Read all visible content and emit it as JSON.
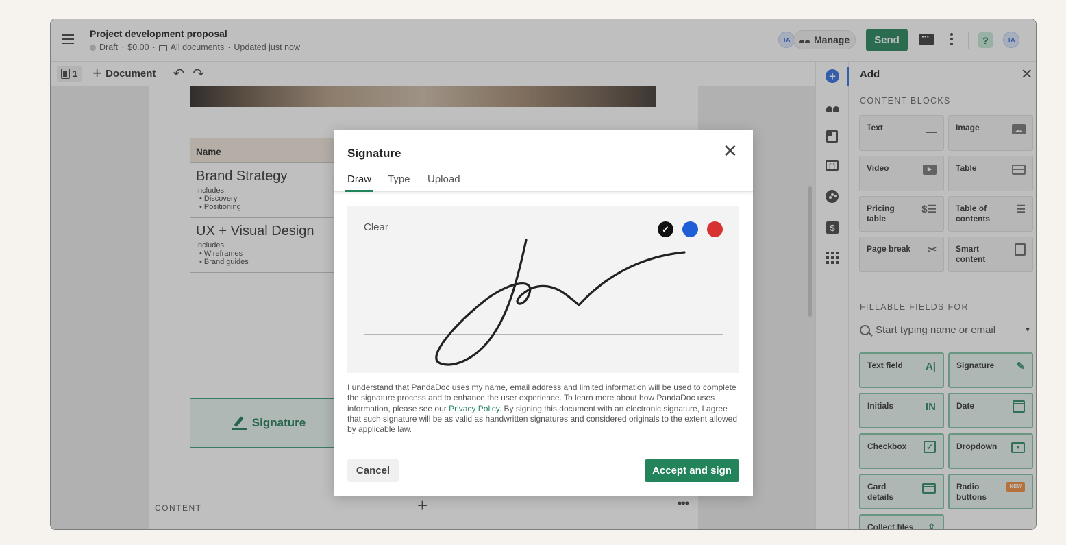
{
  "header": {
    "title": "Project development proposal",
    "status": "Draft",
    "amount": "$0.00",
    "folder": "All documents",
    "updated": "Updated just now",
    "avatar_initials": "TA",
    "manage_label": "Manage",
    "send_label": "Send",
    "help_label": "?",
    "avatar2_initials": "TA"
  },
  "toolbar": {
    "pages_count": "1",
    "add_document_label": "Document"
  },
  "document": {
    "table_header": "Name",
    "rows": [
      {
        "title": "Brand Strategy",
        "includes": "Includes:",
        "items": [
          "• Discovery",
          "• Positioning"
        ]
      },
      {
        "title": "UX + Visual Design",
        "includes": "Includes:",
        "items": [
          "• Wireframes",
          "• Brand guides"
        ]
      }
    ],
    "signature_field_label": "Signature",
    "content_label": "CONTENT",
    "content_add": "+",
    "content_more": "•••"
  },
  "panel": {
    "title": "Add",
    "content_blocks_label": "CONTENT BLOCKS",
    "content_blocks": [
      {
        "label": "Text",
        "icon": "text-icon"
      },
      {
        "label": "Image",
        "icon": "image-icon"
      },
      {
        "label": "Video",
        "icon": "video-icon"
      },
      {
        "label": "Table",
        "icon": "table-icon"
      },
      {
        "label": "Pricing table",
        "icon": "pricing-icon",
        "glyph": "$☰"
      },
      {
        "label": "Table of contents",
        "icon": "toc-icon",
        "glyph": "☰"
      },
      {
        "label": "Page break",
        "icon": "scissors-icon",
        "glyph": "✂"
      },
      {
        "label": "Smart content",
        "icon": "smart-content-icon"
      }
    ],
    "fillable_label": "FILLABLE FIELDS FOR",
    "recipient_placeholder": "Start typing name or email",
    "fields": [
      {
        "label": "Text field",
        "icon": "text-field-icon",
        "glyph": "A|"
      },
      {
        "label": "Signature",
        "icon": "signature-icon",
        "glyph": "✎"
      },
      {
        "label": "Initials",
        "icon": "initials-icon",
        "glyph": "IN"
      },
      {
        "label": "Date",
        "icon": "calendar-icon"
      },
      {
        "label": "Checkbox",
        "icon": "checkbox-icon",
        "glyph": "✓"
      },
      {
        "label": "Dropdown",
        "icon": "dropdown-icon",
        "glyph": "▼"
      },
      {
        "label": "Card details",
        "icon": "card-icon"
      },
      {
        "label": "Radio buttons",
        "icon": "new-badge",
        "badge": "NEW"
      },
      {
        "label": "Collect files",
        "icon": "upload-icon",
        "glyph": "⇪"
      }
    ]
  },
  "modal": {
    "title": "Signature",
    "tabs": [
      "Draw",
      "Type",
      "Upload"
    ],
    "active_tab": "Draw",
    "clear_label": "Clear",
    "colors": [
      "#111111",
      "#1e5fd6",
      "#d63232"
    ],
    "selected_color": "#111111",
    "legal_before": "I understand that PandaDoc uses my name, email address and limited information will be used to complete the signature process and to enhance the user experience. To learn more about how PandaDoc uses information, please see our ",
    "privacy_link": "Privacy Policy",
    "legal_after": ". By signing this document with an electronic signature, I agree that such signature will be as valid as handwritten signatures and considered originals to the extent allowed by applicable law.",
    "cancel_label": "Cancel",
    "accept_label": "Accept and sign"
  },
  "colors": {
    "brand_green": "#23845b",
    "accent_blue": "#2f6fe0"
  }
}
